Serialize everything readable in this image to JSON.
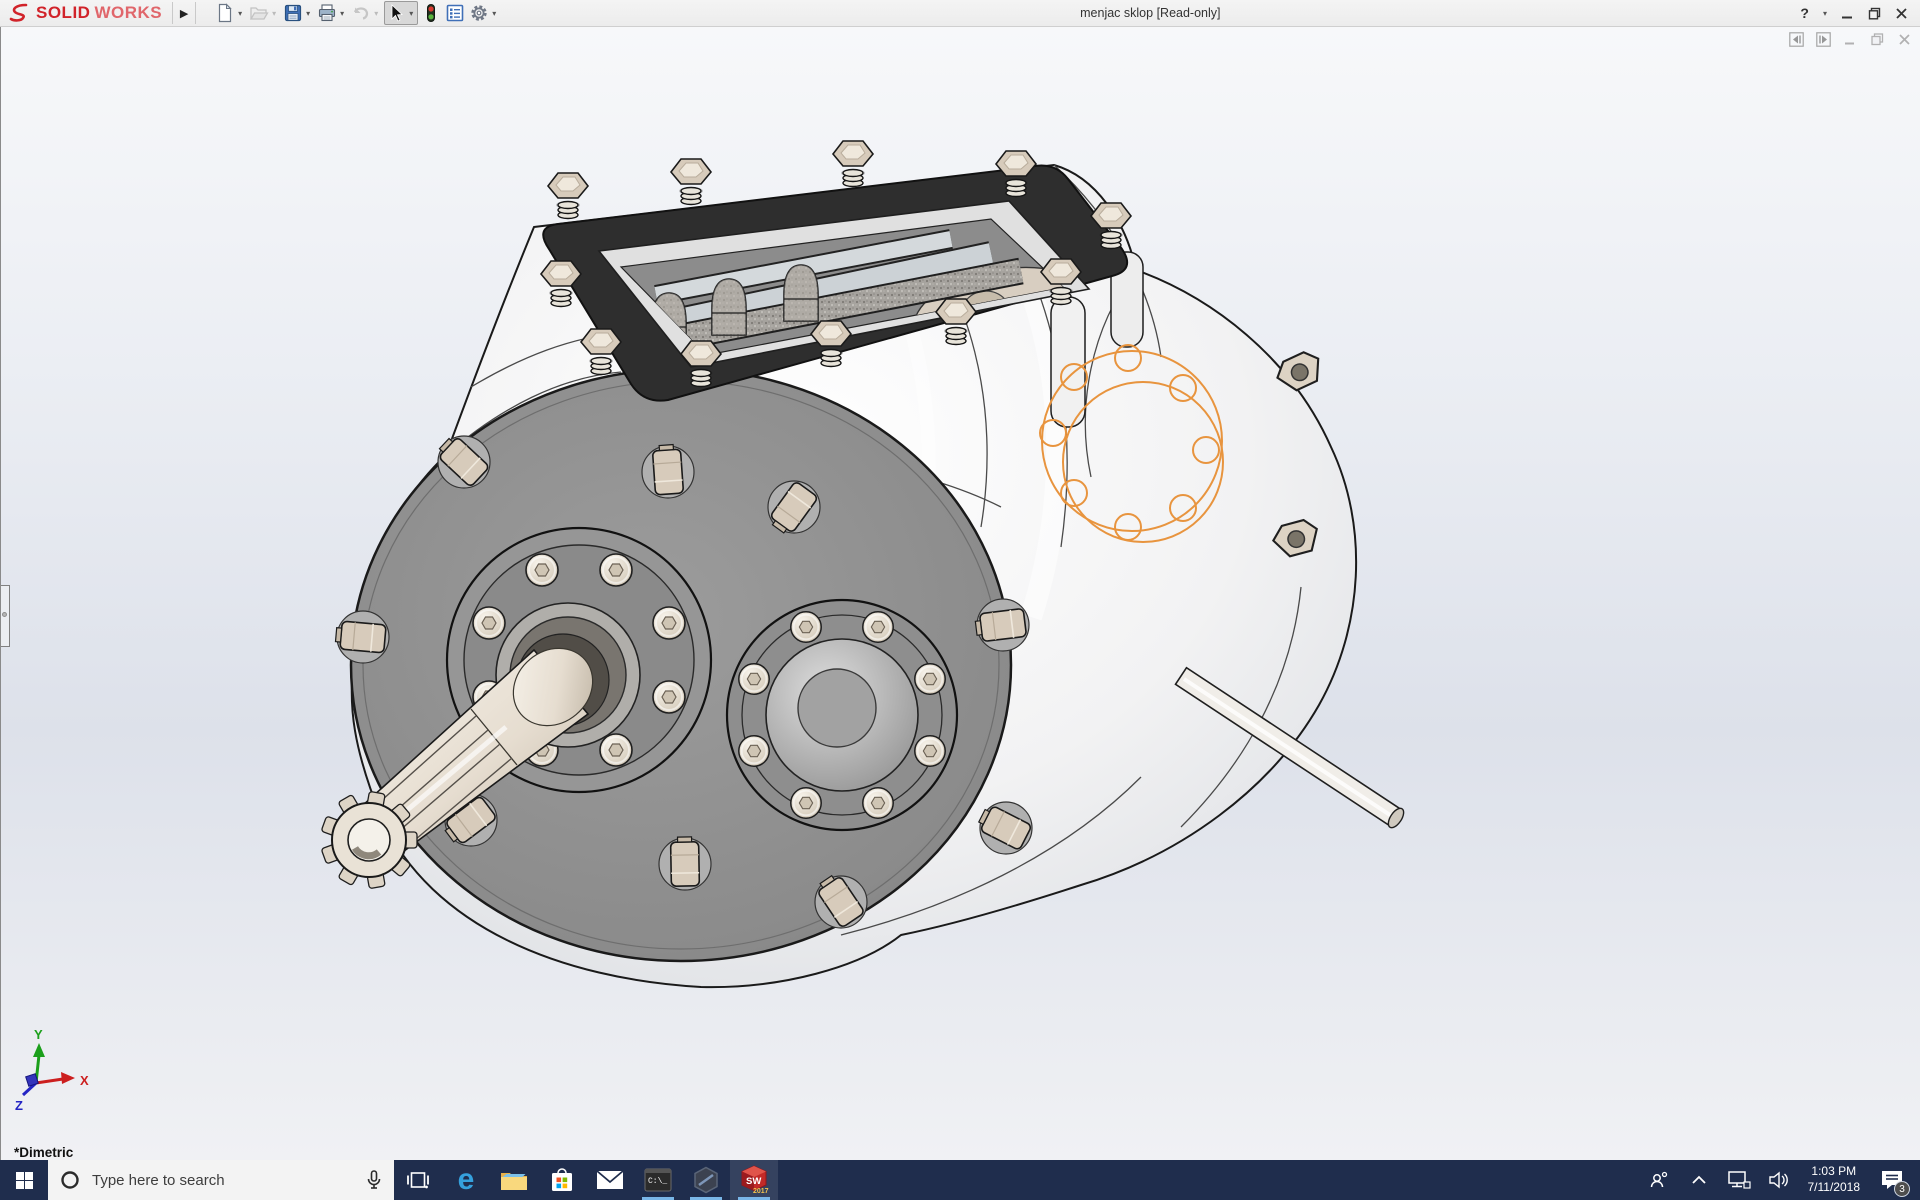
{
  "titlebar": {
    "brand_solid": "SOLID",
    "brand_works": "WORKS",
    "flyout": "▶",
    "caret": "▾",
    "title": "menjac sklop [Read-only]",
    "help": "?"
  },
  "toolbar": {
    "icons": [
      {
        "name": "new-document-icon",
        "enabled": true,
        "dropdown": true
      },
      {
        "name": "open-icon",
        "enabled": false,
        "dropdown": true
      },
      {
        "name": "save-icon",
        "enabled": true,
        "dropdown": true
      },
      {
        "name": "print-icon",
        "enabled": true,
        "dropdown": true
      },
      {
        "name": "undo-icon",
        "enabled": false,
        "dropdown": true
      },
      {
        "name": "select-cursor-icon",
        "enabled": true,
        "dropdown": true,
        "active": true
      },
      {
        "name": "selection-filter-traffic-light-icon",
        "enabled": true,
        "dropdown": false
      },
      {
        "name": "document-properties-icon",
        "enabled": true,
        "dropdown": false
      },
      {
        "name": "options-gear-icon",
        "enabled": true,
        "dropdown": true
      }
    ]
  },
  "document_window_controls": [
    "collapse-left-icon",
    "collapse-right-icon",
    "minimize-icon",
    "restore-icon",
    "close-icon"
  ],
  "viewport": {
    "model": "gearbox-assembly-3d-model",
    "orientation": "*Dimetric",
    "axis_x": "X",
    "axis_y": "Y",
    "axis_z": "Z"
  },
  "taskbar": {
    "search_placeholder": "Type here to search",
    "apps": [
      "start",
      "search",
      "task-view",
      "edge",
      "file-explorer",
      "store",
      "mail",
      "command-prompt",
      "edrawings",
      "solidworks-2017"
    ],
    "edge": "e",
    "cmd": "C:\\_",
    "sw": "SW",
    "sw_year": "2017",
    "time": "1:03 PM",
    "date": "7/11/2018",
    "badge": "3"
  },
  "colors": {
    "sketch_orange": "#e8943e",
    "taskbar_navy": "#1f2d4d",
    "running_underline": "#79b6e8",
    "plate_gray": "#8f8f8f",
    "bolt_beige": "#d7cbbb",
    "gasket_dark": "#2e2e2e"
  }
}
